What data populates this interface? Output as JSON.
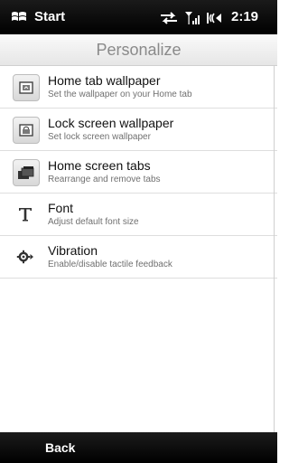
{
  "status_bar": {
    "start_label": "Start",
    "time": "2:19",
    "icons": [
      "windows-logo-icon",
      "sync-arrows-icon",
      "signal-strength-icon",
      "volume-icon"
    ]
  },
  "header": {
    "title": "Personalize"
  },
  "list": {
    "items": [
      {
        "title": "Home tab wallpaper",
        "subtitle": "Set the wallpaper on your Home tab",
        "icon": "home-wallpaper-icon"
      },
      {
        "title": "Lock screen wallpaper",
        "subtitle": "Set lock screen wallpaper",
        "icon": "lock-wallpaper-icon"
      },
      {
        "title": "Home screen tabs",
        "subtitle": "Rearrange and remove tabs",
        "icon": "tabs-icon"
      },
      {
        "title": "Font",
        "subtitle": "Adjust default font size",
        "icon": "font-icon"
      },
      {
        "title": "Vibration",
        "subtitle": "Enable/disable tactile feedback",
        "icon": "vibration-gear-icon"
      }
    ]
  },
  "softkeys": {
    "left_label": "Back"
  },
  "colors": {
    "status_bar_bg": "#000000",
    "title_color": "#8a8a8a",
    "item_title_color": "#111111",
    "item_subtitle_color": "#707070"
  }
}
